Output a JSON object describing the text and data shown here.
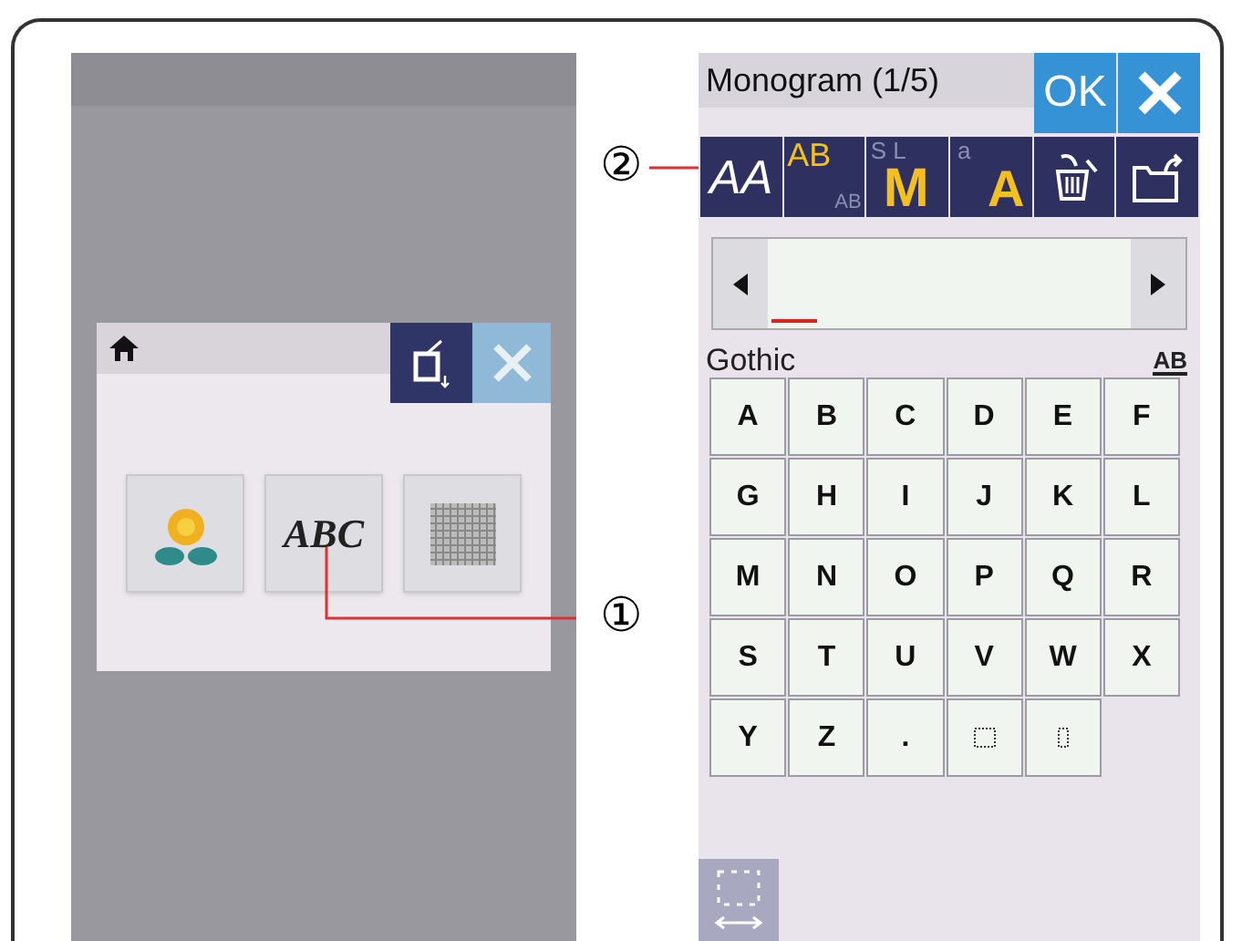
{
  "left_screen": {
    "dialog": {
      "buttons": [
        {
          "kind": "embroidery"
        },
        {
          "kind": "monogram",
          "label": "ABC"
        },
        {
          "kind": "grid"
        }
      ]
    },
    "callout": "①"
  },
  "right_screen": {
    "title": "Monogram (1/5)",
    "ok": "OK",
    "callout": "②",
    "toolbar": [
      {
        "kind": "font",
        "label": "AA"
      },
      {
        "kind": "case",
        "label": "AB",
        "sub": "AB"
      },
      {
        "kind": "size",
        "label": "M",
        "sub": "S L"
      },
      {
        "kind": "lower",
        "label": "A",
        "sub": "a"
      },
      {
        "kind": "delete"
      },
      {
        "kind": "open"
      }
    ],
    "font_name": "Gothic",
    "direction": "AB",
    "keys": [
      {
        "kind": "char",
        "label": "A"
      },
      {
        "kind": "char",
        "label": "B"
      },
      {
        "kind": "char",
        "label": "C"
      },
      {
        "kind": "char",
        "label": "D"
      },
      {
        "kind": "char",
        "label": "E"
      },
      {
        "kind": "char",
        "label": "F"
      },
      {
        "kind": "char",
        "label": "G"
      },
      {
        "kind": "char",
        "label": "H"
      },
      {
        "kind": "char",
        "label": "I"
      },
      {
        "kind": "char",
        "label": "J"
      },
      {
        "kind": "char",
        "label": "K"
      },
      {
        "kind": "char",
        "label": "L"
      },
      {
        "kind": "char",
        "label": "M"
      },
      {
        "kind": "char",
        "label": "N"
      },
      {
        "kind": "char",
        "label": "O"
      },
      {
        "kind": "char",
        "label": "P"
      },
      {
        "kind": "char",
        "label": "Q"
      },
      {
        "kind": "char",
        "label": "R"
      },
      {
        "kind": "char",
        "label": "S"
      },
      {
        "kind": "char",
        "label": "T"
      },
      {
        "kind": "char",
        "label": "U"
      },
      {
        "kind": "char",
        "label": "V"
      },
      {
        "kind": "char",
        "label": "W"
      },
      {
        "kind": "char",
        "label": "X"
      },
      {
        "kind": "char",
        "label": "Y"
      },
      {
        "kind": "char",
        "label": "Z"
      },
      {
        "kind": "char",
        "label": "."
      },
      {
        "kind": "space-wide"
      },
      {
        "kind": "space-narrow"
      }
    ]
  }
}
